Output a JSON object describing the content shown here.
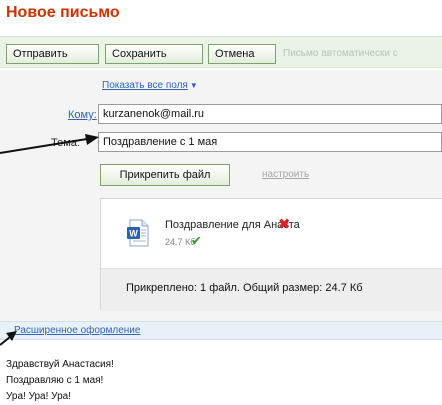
{
  "page": {
    "title": "Новое письмо"
  },
  "toolbar": {
    "send_label": "Отправить",
    "save_label": "Сохранить",
    "cancel_label": "Отмена",
    "auto_save_note": "Письмо автоматически с"
  },
  "form": {
    "show_all_fields_label": "Показать все поля",
    "to_label": "Кому:",
    "to_value": "kurzanenok@mail.ru",
    "subject_label": "Тема:",
    "subject_value": "Поздравление с 1 мая",
    "attach_button_label": "Прикрепить файл",
    "configure_label": "настроить"
  },
  "attachments": {
    "file_name": "Поздравление для Анаста",
    "file_size": "24.7 Кб",
    "summary": "Прикреплено: 1 файл. Общий размер: 24.7 Кб"
  },
  "editor": {
    "rich_formatting_label": "Расширенное оформление",
    "body_lines": [
      "Здравствуй Анастасия!",
      "Поздравляю с 1 мая!",
      "Ура! Ура! Ура!"
    ]
  },
  "icons": {
    "show_fields_chevron": "chevron-down-icon",
    "file_icon": "word-document-icon",
    "remove_icon": "close-icon",
    "check_icon": "check-icon"
  },
  "colors": {
    "title": "#cc3300",
    "toolbar_bg": "#eaf3e6",
    "button_border": "#7aa56b",
    "link": "#2f64b8",
    "form_bg": "#f4f4f4",
    "summary_bg": "#eeeeee",
    "remove": "#dd2222",
    "check": "#2e9a2e",
    "rich_bar_bg": "#e9f1f8"
  }
}
